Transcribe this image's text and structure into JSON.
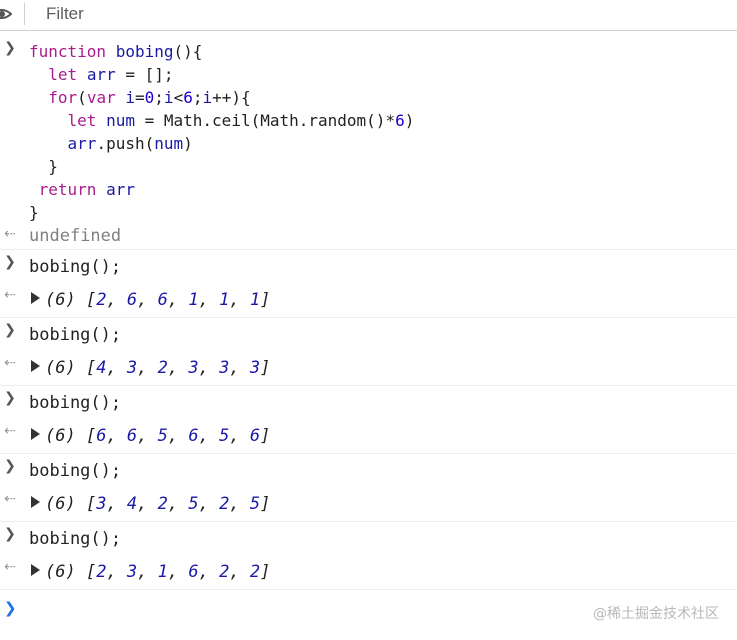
{
  "toolbar": {
    "filter_placeholder": "Filter"
  },
  "code_lines": [
    "function bobing(){",
    "  let arr = [];",
    "  for(var i=0;i<6;i++){",
    "    let num = Math.ceil(Math.random()*6)",
    "    arr.push(num)",
    "  }",
    " return arr",
    "}"
  ],
  "first_result": "undefined",
  "calls": [
    {
      "command": "bobing();",
      "count": "(6)",
      "values": [
        2,
        6,
        6,
        1,
        1,
        1
      ]
    },
    {
      "command": "bobing();",
      "count": "(6)",
      "values": [
        4,
        3,
        2,
        3,
        3,
        3
      ]
    },
    {
      "command": "bobing();",
      "count": "(6)",
      "values": [
        6,
        6,
        5,
        6,
        5,
        6
      ]
    },
    {
      "command": "bobing();",
      "count": "(6)",
      "values": [
        3,
        4,
        2,
        5,
        2,
        5
      ]
    },
    {
      "command": "bobing();",
      "count": "(6)",
      "values": [
        2,
        3,
        1,
        6,
        2,
        2
      ]
    }
  ],
  "watermark": "@稀土掘金技术社区",
  "icons": {
    "prompt": "chevron-right-icon",
    "return": "return-arrow-icon",
    "expand": "triangle-right-icon",
    "visibility": "eye-icon"
  }
}
